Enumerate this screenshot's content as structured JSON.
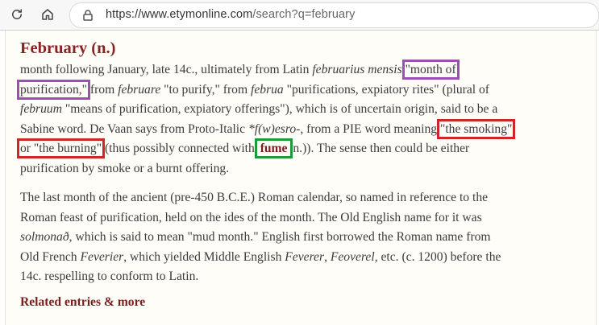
{
  "browser": {
    "url_host": "https://www.etymonline.com",
    "url_path": "/search?q=february"
  },
  "entry": {
    "title": "February (n.)",
    "para1": {
      "l1_a": "month following January, late 14c., ultimately from Latin ",
      "l1_i": "februarius mensis",
      "l1_hl": "\"month of",
      "l2_hl": "purification,\"",
      "l2_a": " from ",
      "l2_i": "februare",
      "l2_b": " \"to purify,\" from ",
      "l2_i2": "februa",
      "l2_c": " \"purifications, expiatory rites\" (plural of",
      "l3_i": "februum",
      "l3_a": " \"means of purification, expiatory offerings\"), which is of uncertain origin, said to be a",
      "l4_a": "Sabine word. De Vaan says from Proto-Italic ",
      "l4_i": "*f(w)esro-",
      "l4_b": ", from a PIE word meaning ",
      "l4_hl": "\"the smoking\"",
      "l5_hl": "or \"the burning\"",
      "l5_a": " (thus possibly connected with ",
      "l5_link": "fume",
      "l5_b": " n.)). The sense then could be either",
      "l6": "purification by smoke or a burnt offering."
    },
    "para2": {
      "l1": "The last month of the ancient (pre-450 B.C.E.) Roman calendar, so named in reference to the",
      "l2": "Roman feast of purification, held on the ides of the month. The Old English name for it was",
      "l3_i": "solmonað",
      "l3_a": ", which is said to mean \"mud month.\" English first borrowed the Roman name from",
      "l4_a": "Old French ",
      "l4_i": "Feverier",
      "l4_b": ", which yielded Middle English ",
      "l4_i2": "Feverer",
      "l4_c": ", ",
      "l4_i3": "Feoverel",
      "l4_d": ", etc. (c. 1200) before the",
      "l5": "14c. respelling to conform to Latin."
    },
    "related_label": "Related entries & more"
  },
  "colors": {
    "highlight_purple": "#9b4fb0",
    "highlight_red": "#d0242b",
    "highlight_green": "#1f9a3a",
    "title": "#862323"
  }
}
